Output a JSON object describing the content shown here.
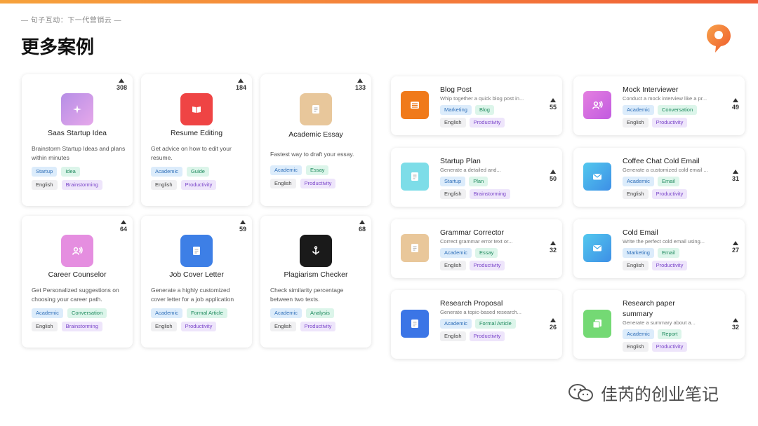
{
  "header": {
    "subtitle": "— 句子互动：下一代营销云 —",
    "title": "更多案例"
  },
  "icons": {
    "logo": "speech-bubble-logo",
    "watermark": "wechat-icon"
  },
  "vertical_cards": [
    {
      "title": "Saas Startup Idea",
      "desc": "Brainstorm Startup Ideas and plans within minutes",
      "votes": "308",
      "icon": "sparkle-icon",
      "color": "#c59be6",
      "tags": [
        "Startup",
        "Idea",
        "English",
        "Brainstorming"
      ]
    },
    {
      "title": "Resume Editing",
      "desc": "Get advice on how to edit your resume.",
      "votes": "184",
      "icon": "book-icon",
      "color": "#ef4444",
      "tags": [
        "Academic",
        "Guide",
        "English",
        "Productivity"
      ]
    },
    {
      "title": "Academic Essay",
      "desc": "Fastest way to draft your essay.",
      "votes": "133",
      "icon": "document-icon",
      "color": "#e8c79b",
      "tags": [
        "Academic",
        "Essay",
        "English",
        "Productivity"
      ]
    },
    {
      "title": "Career Counselor",
      "desc": "Get Personalized suggestions on choosing your career path.",
      "votes": "64",
      "icon": "person-voice-icon",
      "color": "#e58ee0",
      "tags": [
        "Academic",
        "Conversation",
        "English",
        "Brainstorming"
      ]
    },
    {
      "title": "Job Cover Letter",
      "desc": "Generate a highly customized cover letter for a job application",
      "votes": "59",
      "icon": "document-icon",
      "color": "#3d7fe6",
      "tags": [
        "Academic",
        "Formal Article",
        "English",
        "Productivity"
      ]
    },
    {
      "title": "Plagiarism Checker",
      "desc": "Check similarity percentage between two texts.",
      "votes": "68",
      "icon": "anchor-icon",
      "color": "#1a1a1a",
      "tags": [
        "Academic",
        "Analysis",
        "English",
        "Productivity"
      ]
    }
  ],
  "horizontal_cards": [
    {
      "title": "Blog Post",
      "desc": "Whip together a quick blog post in...",
      "votes": "55",
      "icon": "list-icon",
      "color": "#f07a1a",
      "tags": [
        "Marketing",
        "Blog",
        "English",
        "Productivity"
      ]
    },
    {
      "title": "Mock Interviewer",
      "desc": "Conduct a mock interview like a pr...",
      "votes": "49",
      "icon": "person-voice-icon",
      "color": "#de6fd8",
      "tags": [
        "Academic",
        "Conversation",
        "English",
        "Productivity"
      ]
    },
    {
      "title": "Startup Plan",
      "desc": "Generate a detailed and...",
      "votes": "50",
      "icon": "document-icon",
      "color": "#7ddde8",
      "tags": [
        "Startup",
        "Plan",
        "English",
        "Brainstorming"
      ]
    },
    {
      "title": "Coffee Chat Cold Email",
      "desc": "Generate a customized cold email ...",
      "votes": "31",
      "icon": "mail-icon",
      "color": "#42a9e8",
      "tags": [
        "Academic",
        "Email",
        "English",
        "Productivity"
      ]
    },
    {
      "title": "Grammar Corrector",
      "desc": "Correct grammar error text or...",
      "votes": "32",
      "icon": "document-icon",
      "color": "#e9c79a",
      "tags": [
        "Academic",
        "Essay",
        "English",
        "Productivity"
      ]
    },
    {
      "title": "Cold Email",
      "desc": "Write the perfect cold email using...",
      "votes": "27",
      "icon": "mail-icon",
      "color": "#40b0ea",
      "tags": [
        "Marketing",
        "Email",
        "English",
        "Productivity"
      ]
    },
    {
      "title": "Research Proposal",
      "desc": "Generate a topic-based research...",
      "votes": "26",
      "icon": "document-icon",
      "color": "#3b75e6",
      "tags": [
        "Academic",
        "Formal Article",
        "English",
        "Productivity"
      ]
    },
    {
      "title": "Research paper summary",
      "desc": "Generate a summary about a...",
      "votes": "32",
      "icon": "copy-icon",
      "color": "#74d974",
      "tags": [
        "Academic",
        "Report",
        "English",
        "Productivity"
      ]
    }
  ],
  "watermark": {
    "text": "佳芮的创业笔记"
  }
}
